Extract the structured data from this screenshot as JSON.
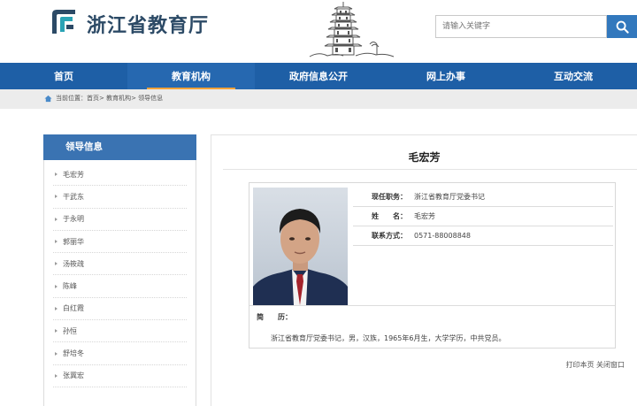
{
  "header": {
    "site_title": "浙江省教育厅",
    "search_placeholder": "请输入关键字"
  },
  "nav": {
    "items": [
      {
        "label": "首页",
        "active": false
      },
      {
        "label": "教育机构",
        "active": true
      },
      {
        "label": "政府信息公开",
        "active": false
      },
      {
        "label": "网上办事",
        "active": false
      },
      {
        "label": "互动交流",
        "active": false
      }
    ]
  },
  "breadcrumb": {
    "text": "当前位置：首页> 教育机构> 领导信息"
  },
  "sidebar": {
    "title": "领导信息",
    "items": [
      "毛宏芳",
      "干武东",
      "于永明",
      "郭丽华",
      "汤筱疏",
      "陈峰",
      "白红霞",
      "孙恒",
      "舒培冬",
      "张冀宏"
    ]
  },
  "profile": {
    "name": "毛宏芳",
    "fields": [
      {
        "label": "现任职务：",
        "value": "浙江省教育厅党委书记"
      },
      {
        "label": "姓　　名：",
        "value": "毛宏芳"
      },
      {
        "label": "联系方式：",
        "value": "0571-88008848"
      }
    ],
    "bio_label": "简　　历：",
    "bio_text": "浙江省教育厅党委书记，男，汉族，1965年6月生，大学学历，中共党员。"
  },
  "footer_links": {
    "text": "打印本页 关闭窗口"
  },
  "colors": {
    "nav_bg": "#1e5fa6",
    "accent": "#f2a33a",
    "sidebar_head": "#3a73b2",
    "search_button": "#3278bd"
  }
}
